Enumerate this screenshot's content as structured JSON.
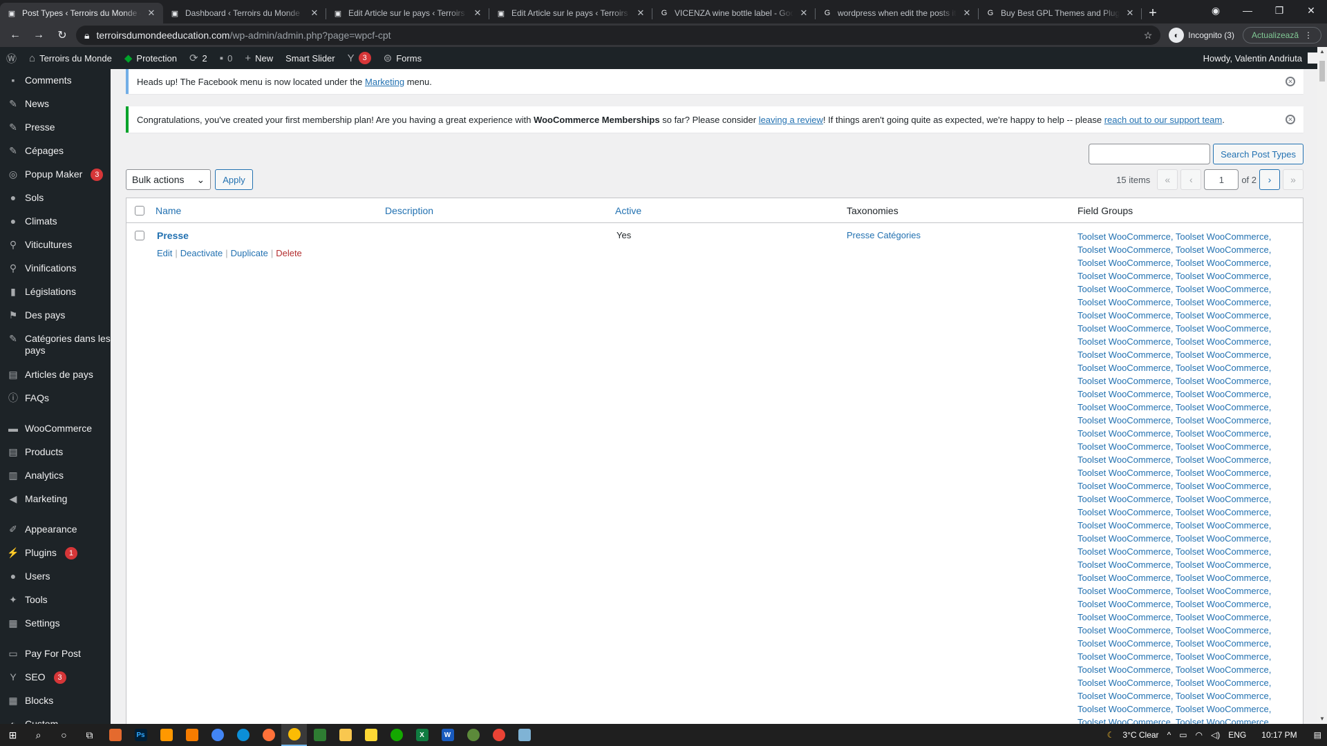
{
  "browser": {
    "tabs": [
      {
        "title": "Post Types ‹ Terroirs du Monde —",
        "active": true
      },
      {
        "title": "Dashboard ‹ Terroirs du Monde",
        "active": false
      },
      {
        "title": "Edit Article sur le pays ‹ Terroirs",
        "active": false
      },
      {
        "title": "Edit Article sur le pays ‹ Terroirs",
        "active": false
      },
      {
        "title": "VICENZA wine bottle label - Goo",
        "active": false
      },
      {
        "title": "wordpress when edit the posts it",
        "active": false
      },
      {
        "title": "Buy Best GPL Themes and Plugin",
        "active": false
      }
    ],
    "url_domain": "terroirsdumondeeducation.com",
    "url_path": "/wp-admin/admin.php?page=wpcf-cpt",
    "incognito_label": "Incognito (3)",
    "update_label": "Actualizează"
  },
  "adminbar": {
    "site_name": "Terroirs du Monde",
    "protection": "Protection",
    "updates_count": "2",
    "comments_count": "0",
    "new_label": "New",
    "smart_slider": "Smart Slider",
    "yoast_count": "3",
    "forms": "Forms",
    "howdy": "Howdy, Valentin Andriuta"
  },
  "sidebar": {
    "items": [
      {
        "label": "Comments",
        "icon": "comment-icon"
      },
      {
        "label": "News",
        "icon": "pin-icon"
      },
      {
        "label": "Presse",
        "icon": "pin-icon"
      },
      {
        "label": "Cépages",
        "icon": "pin-icon"
      },
      {
        "label": "Popup Maker",
        "icon": "popup-icon",
        "badge": "3"
      },
      {
        "label": "Sols",
        "icon": "globe-icon"
      },
      {
        "label": "Climats",
        "icon": "globe-icon"
      },
      {
        "label": "Viticultures",
        "icon": "person-icon"
      },
      {
        "label": "Vinifications",
        "icon": "person-icon"
      },
      {
        "label": "Législations",
        "icon": "book-icon"
      },
      {
        "label": "Des pays",
        "icon": "flag-icon"
      },
      {
        "label": "Catégories dans les pays",
        "icon": "pin-icon",
        "two_line": true
      },
      {
        "label": "Articles de pays",
        "icon": "archive-icon"
      },
      {
        "label": "FAQs",
        "icon": "info-icon"
      },
      {
        "label": "WooCommerce",
        "icon": "woo-icon",
        "gap": true
      },
      {
        "label": "Products",
        "icon": "archive-icon"
      },
      {
        "label": "Analytics",
        "icon": "chart-icon"
      },
      {
        "label": "Marketing",
        "icon": "megaphone-icon"
      },
      {
        "label": "Appearance",
        "icon": "brush-icon",
        "gap": true
      },
      {
        "label": "Plugins",
        "icon": "plug-icon",
        "badge": "1"
      },
      {
        "label": "Users",
        "icon": "user-icon"
      },
      {
        "label": "Tools",
        "icon": "wrench-icon"
      },
      {
        "label": "Settings",
        "icon": "settings-icon"
      },
      {
        "label": "Pay For Post",
        "icon": "cart-icon",
        "gap": true
      },
      {
        "label": "SEO",
        "icon": "yoast-icon",
        "badge": "3"
      },
      {
        "label": "Blocks",
        "icon": "blocks-icon"
      },
      {
        "label": "Custom...",
        "icon": "custom-icon"
      }
    ]
  },
  "notices": {
    "facebook": {
      "pre": "Heads up! The Facebook menu is now located under the ",
      "link": "Marketing",
      "post": " menu."
    },
    "membership": {
      "pre": "Congratulations, you've created your first membership plan! Are you having a great experience with ",
      "bold": "WooCommerce Memberships",
      "mid": " so far? Please consider ",
      "link1": "leaving a review",
      "mid2": "! If things aren't going quite as expected, we're happy to help -- please ",
      "link2": "reach out to our support team",
      "post": "."
    }
  },
  "toolbar": {
    "search_button": "Search Post Types",
    "bulk_actions": "Bulk actions",
    "apply": "Apply",
    "items_count": "15 items",
    "current_page": "1",
    "of_pages": "of 2",
    "first": "«",
    "prev": "‹",
    "next": "›",
    "last": "»"
  },
  "table": {
    "headers": {
      "name": "Name",
      "description": "Description",
      "active": "Active",
      "taxonomies": "Taxonomies",
      "field_groups": "Field Groups"
    },
    "rows": [
      {
        "name": "Presse",
        "actions": {
          "edit": "Edit",
          "deactivate": "Deactivate",
          "duplicate": "Duplicate",
          "delete": "Delete"
        },
        "active": "Yes",
        "taxonomies": "Presse Catégories",
        "field_groups_line": "Toolset WooCommerce, Toolset WooCommerce,",
        "field_groups_lines": 38
      }
    ]
  },
  "taskbar": {
    "weather": "3°C  Clear",
    "lang": "ENG",
    "time": "10:17 PM"
  },
  "colors": {
    "wp_dark": "#1d2327",
    "wp_blue": "#2271b1",
    "badge_red": "#d63638",
    "success_green": "#00a32a"
  }
}
